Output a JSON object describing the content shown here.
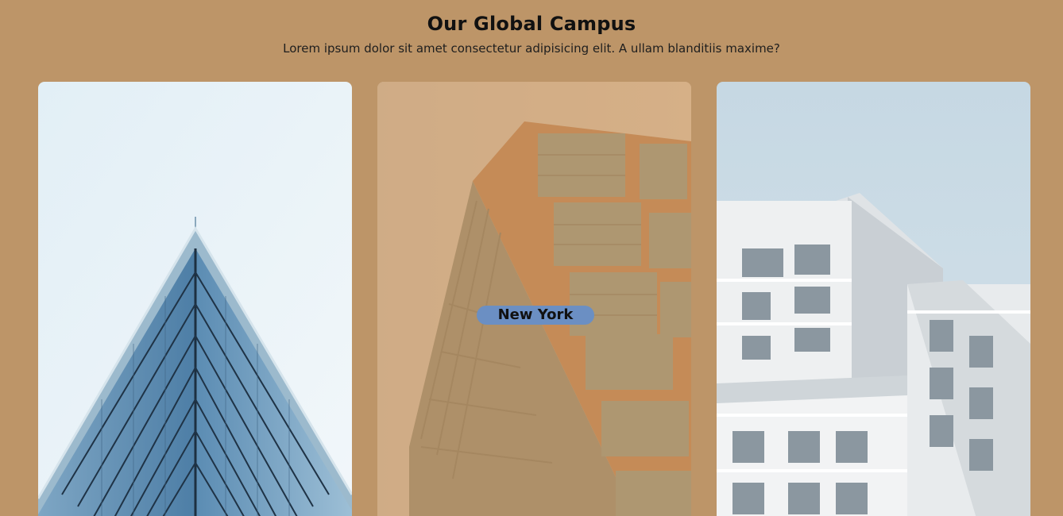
{
  "section": {
    "title": "Our Global Campus",
    "subtitle": "Lorem ipsum dolor sit amet consectetur adipisicing elit. A ullam blanditiis maxime?"
  },
  "campuses": [
    {
      "image": "glass-pyramid-building-image"
    },
    {
      "image": "angled-glass-building-image",
      "label": "New York"
    },
    {
      "image": "white-modular-building-image"
    }
  ],
  "colors": {
    "background": "#bd9568",
    "overlay": "#c99660",
    "label_bg": "#6b8fc3"
  }
}
